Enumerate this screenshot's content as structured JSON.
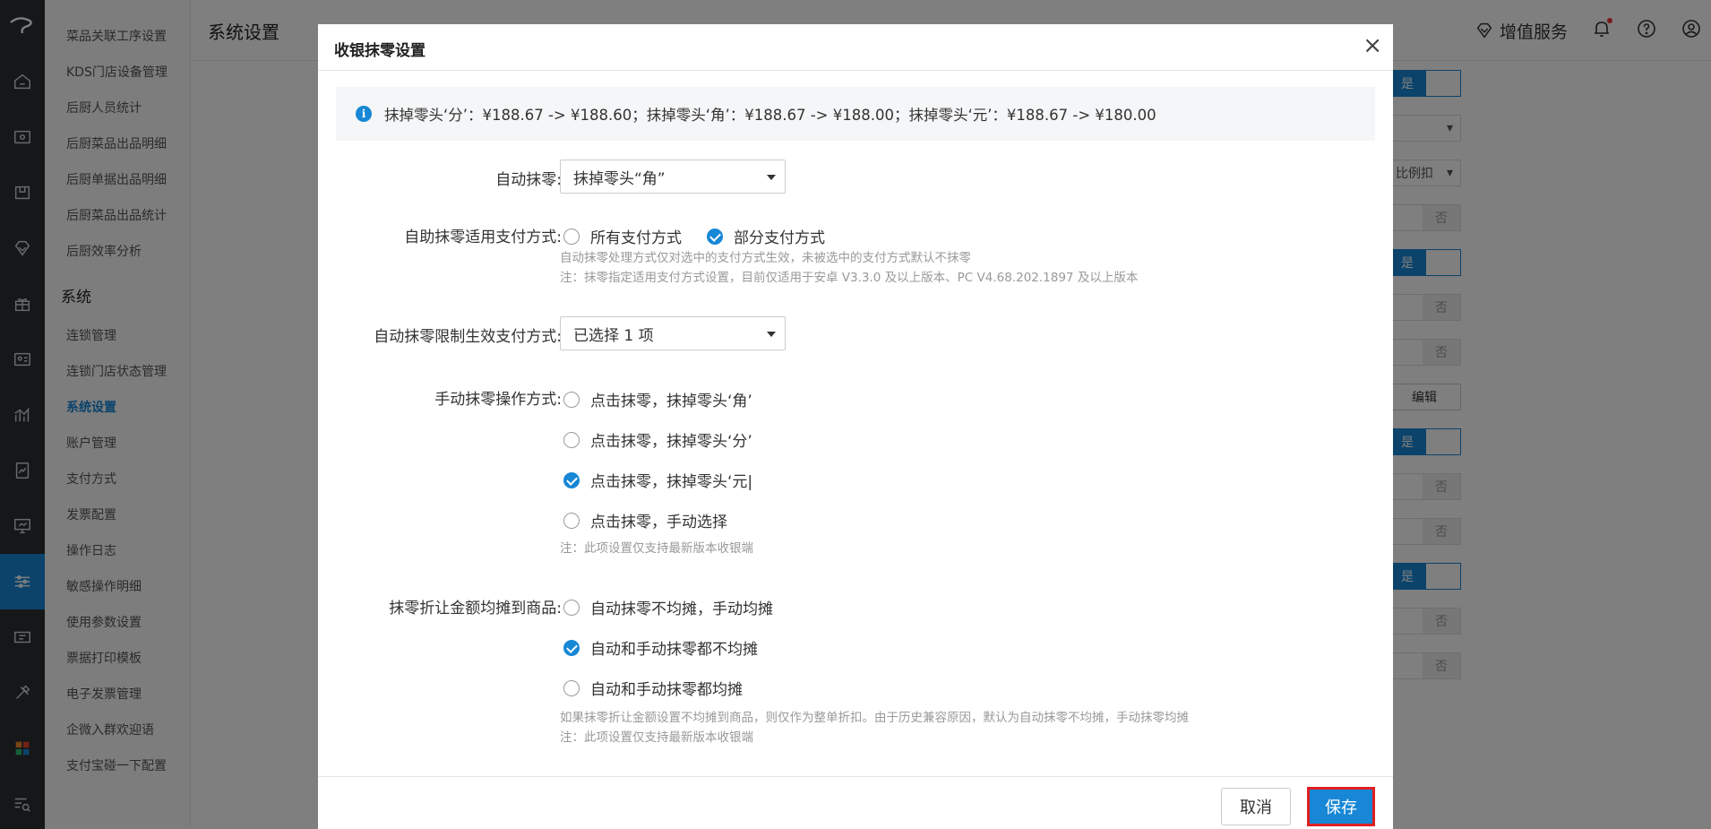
{
  "app": {
    "page_title": "系统设置",
    "value_added": "增值服务"
  },
  "submenu": {
    "items_top": [
      "菜品关联工序设置",
      "KDS门店设备管理",
      "后厨人员统计",
      "后厨菜品出品明细",
      "后厨单据出品明细",
      "后厨菜品出品统计",
      "后厨效率分析"
    ],
    "group": "系统",
    "items_system": [
      "连锁管理",
      "连锁门店状态管理",
      "系统设置",
      "账户管理",
      "支付方式",
      "发票配置",
      "操作日志",
      "敏感操作明细",
      "使用参数设置",
      "票据打印模板",
      "电子发票管理",
      "企微入群欢迎语",
      "支付宝碰一下配置"
    ],
    "active": "系统设置"
  },
  "background": {
    "yes": "是",
    "no": "否",
    "proportional": "比例扣",
    "edit": "编辑"
  },
  "modal": {
    "title": "收银抹零设置",
    "close": "×",
    "info": "抹掉零头‘分’：¥188.67 -> ¥188.60；抹掉零头‘角’：¥188.67 -> ¥188.00；抹掉零头‘元’：¥188.67 -> ¥180.00",
    "auto_round": {
      "label": "自动抹零:",
      "value": "抹掉零头“角”"
    },
    "self_pay": {
      "label": "自助抹零适用支付方式:",
      "options": [
        "所有支付方式",
        "部分支付方式"
      ],
      "selected": 1,
      "note1": "自动抹零处理方式仅对选中的支付方式生效，未被选中的支付方式默认不抹零",
      "note2": "注：抹零指定适用支付方式设置，目前仅适用于安卓 V3.3.0 及以上版本、PC V4.68.202.1897 及以上版本"
    },
    "limit_pay": {
      "label": "自动抹零限制生效支付方式:",
      "value": "已选择 1 项"
    },
    "manual": {
      "label": "手动抹零操作方式:",
      "options": [
        "点击抹零，抹掉零头‘角’",
        "点击抹零，抹掉零头‘分’",
        "点击抹零，抹掉零头‘元|",
        "点击抹零，手动选择"
      ],
      "selected": 2,
      "note": "注：此项设置仅支持最新版本收银端"
    },
    "distribute": {
      "label": "抹零折让金额均摊到商品:",
      "options": [
        "自动抹零不均摊，手动均摊",
        "自动和手动抹零都不均摊",
        "自动和手动抹零都均摊"
      ],
      "selected": 1,
      "note1": "如果抹零折让金额设置不均摊到商品，则仅作为整单折扣。由于历史兼容原因，默认为自动抹零不均摊，手动抹零均摊",
      "note2": "注：此项设置仅支持最新版本收银端"
    },
    "buttons": {
      "cancel": "取消",
      "save": "保存"
    }
  },
  "colors": {
    "accent": "#1787d6",
    "save_border": "#e02020",
    "rail_bg": "#2b2f33"
  }
}
